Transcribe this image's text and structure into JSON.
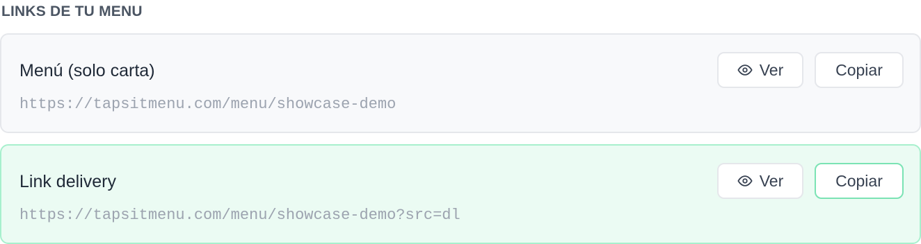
{
  "section": {
    "title": "LINKS DE TU MENU"
  },
  "links": [
    {
      "name": "Menú (solo carta)",
      "url": "https://tapsitmenu.com/menu/showcase-demo",
      "view_label": "Ver",
      "copy_label": "Copiar",
      "view_icon": "eye-icon"
    },
    {
      "name": "Link delivery",
      "url": "https://tapsitmenu.com/menu/showcase-demo?src=dl",
      "view_label": "Ver",
      "copy_label": "Copiar",
      "view_icon": "eye-icon"
    }
  ],
  "colors": {
    "card_default_bg": "#f8f9fb",
    "card_highlight_bg": "#ebfbf3",
    "card_highlight_border": "#a7f0cd",
    "copy_highlight_border": "#7be3b4"
  }
}
